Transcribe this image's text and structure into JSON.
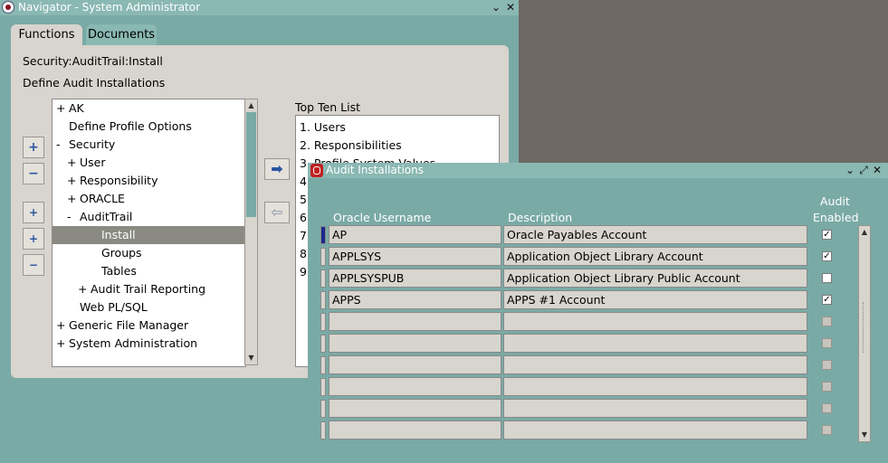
{
  "navigator": {
    "title": "Navigator - System Administrator",
    "tabs": [
      "Functions",
      "Documents"
    ],
    "path": "Security:AuditTrail:Install",
    "function_name": "Define Audit Installations",
    "tree": [
      {
        "prefix": "+",
        "label": "AK",
        "level": 0
      },
      {
        "prefix": "",
        "label": "Define Profile Options",
        "level": 0
      },
      {
        "prefix": "-",
        "label": "Security",
        "level": 0
      },
      {
        "prefix": "+",
        "label": "User",
        "level": 1
      },
      {
        "prefix": "+",
        "label": "Responsibility",
        "level": 1
      },
      {
        "prefix": "+",
        "label": "ORACLE",
        "level": 1
      },
      {
        "prefix": "-",
        "label": "AuditTrail",
        "level": 1
      },
      {
        "prefix": "",
        "label": "Install",
        "level": 2,
        "selected": true
      },
      {
        "prefix": "",
        "label": "Groups",
        "level": 2
      },
      {
        "prefix": "",
        "label": "Tables",
        "level": 2
      },
      {
        "prefix": "+",
        "label": "Audit Trail Reporting",
        "level": 2
      },
      {
        "prefix": "",
        "label": "Web PL/SQL",
        "level": 1
      },
      {
        "prefix": "+",
        "label": "Generic File Manager",
        "level": 0
      },
      {
        "prefix": "+",
        "label": "System Administration",
        "level": 0
      }
    ],
    "top_ten_label": "Top Ten List",
    "top_ten": [
      "1. Users",
      "2. Responsibilities",
      "3. Profile System Values",
      "4.",
      "5.",
      "6.",
      "7.",
      "8.",
      "9."
    ]
  },
  "audit": {
    "title": "Audit Installations",
    "col_username": "Oracle Username",
    "col_description": "Description",
    "col_enabled_1": "Audit",
    "col_enabled_2": "Enabled",
    "rows": [
      {
        "username": "AP",
        "description": "Oracle Payables Account",
        "enabled": true
      },
      {
        "username": "APPLSYS",
        "description": "Application Object Library Account",
        "enabled": true
      },
      {
        "username": "APPLSYSPUB",
        "description": "Application Object Library Public Account",
        "enabled": false
      },
      {
        "username": "APPS",
        "description": "APPS #1 Account",
        "enabled": true
      },
      {
        "username": "",
        "description": "",
        "enabled": null
      },
      {
        "username": "",
        "description": "",
        "enabled": null
      },
      {
        "username": "",
        "description": "",
        "enabled": null
      },
      {
        "username": "",
        "description": "",
        "enabled": null
      },
      {
        "username": "",
        "description": "",
        "enabled": null
      },
      {
        "username": "",
        "description": "",
        "enabled": null
      }
    ]
  },
  "glyphs": {
    "minimize": "⌄",
    "maximize": "⤢",
    "close": "✕",
    "check": "✓",
    "arrow_right": "➡",
    "arrow_left": "⇦",
    "plus": "+",
    "minus": "−",
    "up": "▲",
    "down": "▼"
  },
  "colors": {
    "window_teal": "#7aaaa5",
    "panel": "#d8d4ce",
    "selection": "#8a8a82",
    "current_record": "#1a2a8a"
  }
}
